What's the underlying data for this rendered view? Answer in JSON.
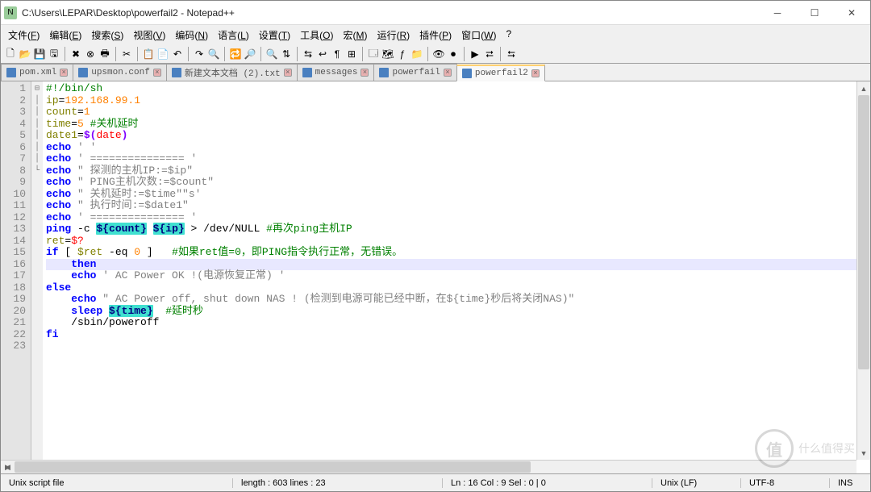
{
  "title": "C:\\Users\\LEPAR\\Desktop\\powerfail2 - Notepad++",
  "menu": [
    "文件(F)",
    "编辑(E)",
    "搜索(S)",
    "视图(V)",
    "编码(N)",
    "语言(L)",
    "设置(T)",
    "工具(O)",
    "宏(M)",
    "运行(R)",
    "插件(P)",
    "窗口(W)",
    "?"
  ],
  "menu_u": [
    "F",
    "E",
    "S",
    "V",
    "N",
    "L",
    "T",
    "O",
    "M",
    "R",
    "P",
    "W",
    ""
  ],
  "toolbar_names": [
    "new",
    "open",
    "save",
    "save-all",
    "close",
    "close-all",
    "print",
    "cut",
    "copy",
    "paste",
    "undo",
    "redo",
    "find",
    "replace",
    "zoom-in",
    "zoom-out",
    "sync-v",
    "sync-h",
    "wrap",
    "show-all",
    "indent-guide",
    "lang",
    "doc-map",
    "func-list",
    "folder",
    "monitor",
    "record",
    "play",
    "rtl",
    "ltr"
  ],
  "toolbar_glyphs": [
    "🗋",
    "📂",
    "💾",
    "🖫",
    "✖",
    "⊗",
    "🖶",
    "✂",
    "📋",
    "📄",
    "↶",
    "↷",
    "🔍",
    "🔁",
    "🔎",
    "🔍",
    "⇅",
    "⇆",
    "↩",
    "¶",
    "⊞",
    "🗔",
    "🗺",
    "ƒ",
    "📁",
    "👁",
    "⏺",
    "▶",
    "⮂",
    "⮀"
  ],
  "tabs": [
    {
      "label": "pom.xml",
      "active": false
    },
    {
      "label": "upsmon.conf",
      "active": false
    },
    {
      "label": "新建文本文档 (2).txt",
      "active": false
    },
    {
      "label": "messages",
      "active": false
    },
    {
      "label": "powerfail",
      "active": false
    },
    {
      "label": "powerfail2",
      "active": true
    }
  ],
  "code": {
    "l1": {
      "cmt": "#!/bin/sh"
    },
    "l2": {
      "a": "ip",
      "b": "=",
      "c": "192.168.99.1"
    },
    "l3": {
      "a": "count",
      "b": "=",
      "c": "1"
    },
    "l4": {
      "a": "time",
      "b": "=",
      "c": "5",
      "d": " #关机延时"
    },
    "l5": {
      "a": "date1",
      "b": "=",
      "c": "$(",
      "d": "date",
      "e": ")"
    },
    "l6": {
      "k": "echo",
      "s": " ' '"
    },
    "l7": {
      "k": "echo",
      "s": " ' =============== '"
    },
    "l8": {
      "k": "echo",
      "s": " \" 探测的主机IP:=$ip\""
    },
    "l9": {
      "k": "echo",
      "s": " \" PING主机次数:=$count\""
    },
    "l10": {
      "k": "echo",
      "s": " \" 关机延时:=$time\"\"s'"
    },
    "l11": {
      "k": "echo",
      "s": " \" 执行时间:=$date1\""
    },
    "l12": {
      "k": "echo",
      "s": " ' =============== '"
    },
    "l13": {
      "k": "ping",
      "a": " -c ",
      "h1": "${count}",
      "sp": " ",
      "h2": "${ip}",
      "b": " > /dev/NULL ",
      "c": "#再次ping主机IP"
    },
    "l14": {
      "a": "ret",
      "b": "=",
      "c": "$?"
    },
    "l15": {
      "k": "if",
      "a": " [ ",
      "v": "$ret",
      "b": " -eq ",
      "n": "0",
      "c": " ]   ",
      "d": "#如果ret值=0，即PING指令执行正常，无错误。"
    },
    "l16": {
      "k": "then"
    },
    "l17": {
      "k": "echo",
      "s": " ' AC Power OK !(电源恢复正常) '"
    },
    "l18": {
      "k": "else"
    },
    "l19": {
      "k": "echo",
      "s": " \" AC Power off, shut down NAS ! (检测到电源可能已经中断，在${time}秒后将关闭NAS)\""
    },
    "l20": {
      "k": "sleep",
      "sp": " ",
      "h": "${time}",
      "c": "  #延时秒"
    },
    "l21": {
      "a": "/sbin/poweroff"
    },
    "l22": {
      "k": "fi"
    }
  },
  "status": {
    "lang": "Unix script file",
    "length": "length : 603    lines : 23",
    "pos": "Ln : 16    Col : 9    Sel : 0 | 0",
    "eol": "Unix (LF)",
    "enc": "UTF-8",
    "ins": "INS"
  },
  "watermark": "什么值得买"
}
